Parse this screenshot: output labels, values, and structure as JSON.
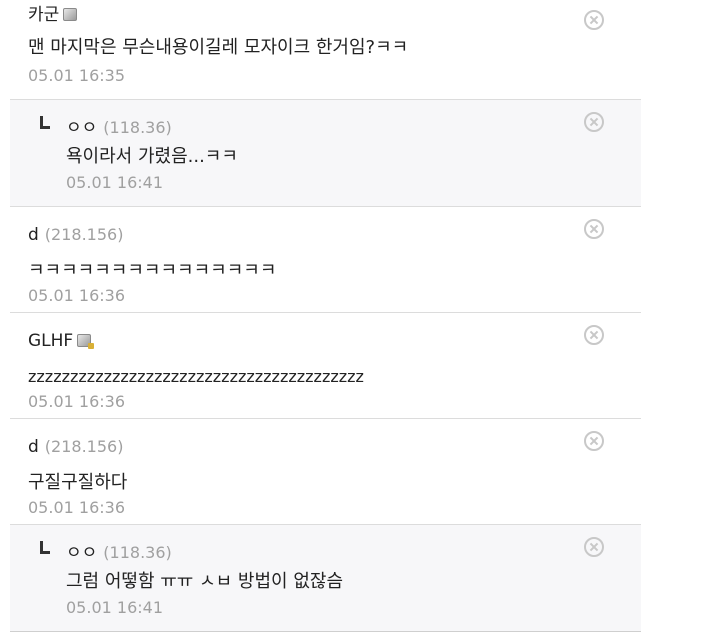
{
  "comments": [
    {
      "type": "top",
      "nick": "카군",
      "ip": "",
      "icon": "gallog-icon",
      "body": "맨 마지막은 무슨내용이길레 모자이크 한거임?ㅋㅋ",
      "date": "05.01 16:35"
    },
    {
      "type": "reply",
      "nick": "ㅇㅇ",
      "ip": "(118.36)",
      "body": "욕이라서 가렸음...ㅋㅋ",
      "date": "05.01 16:41"
    },
    {
      "type": "normal",
      "nick": "d",
      "ip": "(218.156)",
      "body": "ㅋㅋㅋㅋㅋㅋㅋㅋㅋㅋㅋㅋㅋㅋㅋ",
      "date": "05.01 16:36"
    },
    {
      "type": "normal",
      "nick": "GLHF",
      "ip": "",
      "icon": "fixed-gallog-icon",
      "body": "zzzzzzzzzzzzzzzzzzzzzzzzzzzzzzzzzzzzzzzz",
      "date": "05.01 16:36"
    },
    {
      "type": "normal",
      "nick": "d",
      "ip": "(218.156)",
      "body": "구질구질하다",
      "date": "05.01 16:36"
    },
    {
      "type": "reply",
      "nick": "ㅇㅇ",
      "ip": "(118.36)",
      "body": "그럼 어떻함 ㅠㅠ ㅅㅂ 방법이 없잖슴",
      "date": "05.01 16:41"
    }
  ]
}
